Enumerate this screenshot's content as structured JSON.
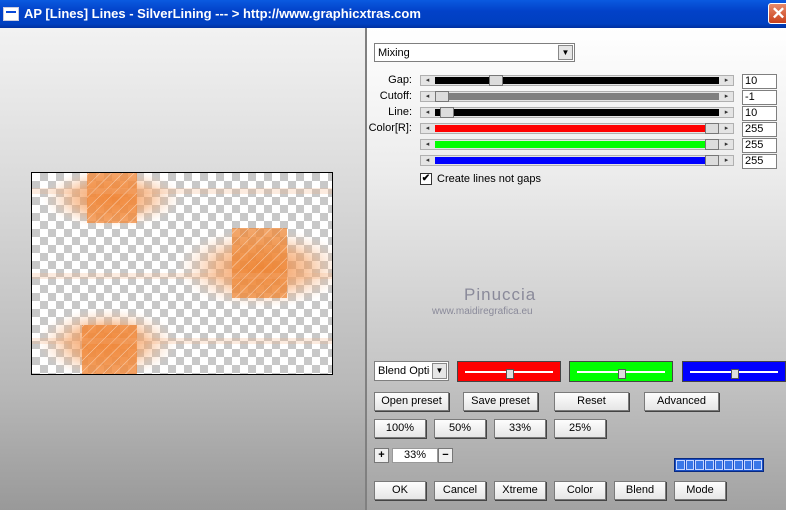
{
  "window": {
    "title": "AP [Lines]  Lines - SilverLining     --- > http://www.graphicxtras.com",
    "close_glyph": "✕"
  },
  "mode_select": {
    "value": "Mixing"
  },
  "params": [
    {
      "label": "Gap:",
      "value": "10",
      "level": 0.2,
      "fill": "#000000"
    },
    {
      "label": "Cutoff:",
      "value": "-1",
      "level": 0.0,
      "fill": "#808080"
    },
    {
      "label": "Line:",
      "value": "10",
      "level": 0.02,
      "fill": "#000000"
    },
    {
      "label": "Color[R]:",
      "value": "255",
      "level": 1.0,
      "fill": "#ff0000"
    },
    {
      "label": "",
      "value": "255",
      "level": 1.0,
      "fill": "#00ff00"
    },
    {
      "label": "",
      "value": "255",
      "level": 1.0,
      "fill": "#0000ff"
    }
  ],
  "checkbox": {
    "label": "Create lines not gaps",
    "checked": true,
    "mark": "✔"
  },
  "watermark": {
    "name": "Pinuccia",
    "url": "www.maidiregrafica.eu"
  },
  "blend_select": {
    "value": "Blend Options"
  },
  "color_blocks": [
    {
      "color": "#ff0000",
      "level": 0.5
    },
    {
      "color": "#00ff00",
      "level": 0.5
    },
    {
      "color": "#0000ff",
      "level": 0.5
    }
  ],
  "buttons": {
    "open_preset": "Open preset",
    "save_preset": "Save preset",
    "reset": "Reset",
    "advanced": "Advanced",
    "z100": "100%",
    "z50": "50%",
    "z33": "33%",
    "z25": "25%",
    "ok": "OK",
    "cancel": "Cancel",
    "xtreme": "Xtreme",
    "color": "Color",
    "blend": "Blend",
    "mode": "Mode"
  },
  "zoom": {
    "plus": "+",
    "value": "33%",
    "minus": "−"
  },
  "colors": {
    "titlebar": "#0241c8",
    "accent_orange": "#f08a3c"
  }
}
